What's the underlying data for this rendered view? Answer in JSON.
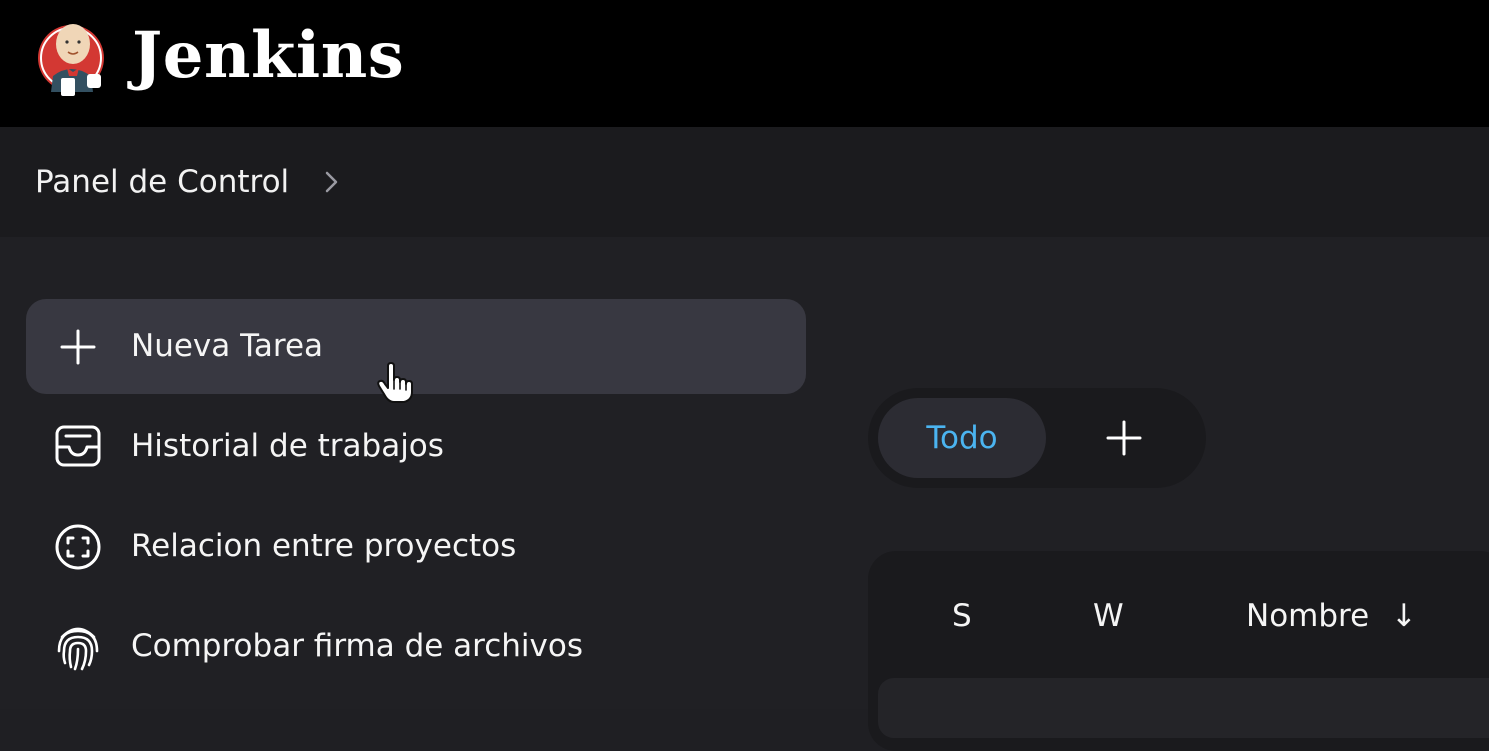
{
  "app": {
    "name": "Jenkins",
    "logo_icon": "jenkins-butler-logo-icon"
  },
  "breadcrumb": {
    "items": [
      {
        "label": "Panel de Control"
      }
    ],
    "separator_icon": "chevron-right-icon"
  },
  "sidebar": {
    "items": [
      {
        "label": "Nueva Tarea",
        "icon": "plus-icon",
        "active": true
      },
      {
        "label": "Historial de trabajos",
        "icon": "inbox-icon",
        "active": false
      },
      {
        "label": "Relacion entre proyectos",
        "icon": "focus-frame-icon",
        "active": false
      },
      {
        "label": "Comprobar firma de archivos",
        "icon": "fingerprint-icon",
        "active": false
      }
    ]
  },
  "views": {
    "tabs": [
      {
        "label": "Todo",
        "selected": true
      }
    ],
    "add_icon": "plus-icon"
  },
  "table": {
    "columns": [
      {
        "label": "S"
      },
      {
        "label": "W"
      },
      {
        "label": "Nombre",
        "sort": "↓"
      }
    ]
  },
  "colors": {
    "header_bg": "#000000",
    "page_bg": "#202024",
    "accent_tab": "#4bb4f0",
    "active_item_bg": "#383841"
  }
}
